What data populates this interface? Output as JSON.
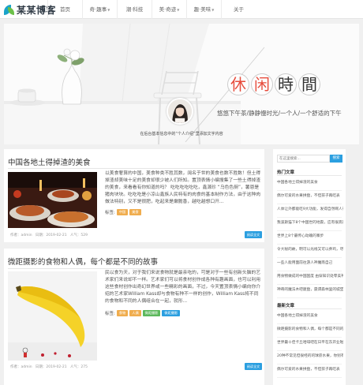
{
  "header": {
    "logo_text": "某某博客",
    "nav": [
      {
        "label": "首页",
        "has_caret": false,
        "width": 44
      },
      {
        "label": "奇·趣事",
        "has_caret": true,
        "width": 44
      },
      {
        "label": "潮·科技",
        "has_caret": false,
        "width": 44
      },
      {
        "label": "美·奇迹",
        "has_caret": true,
        "width": 44
      },
      {
        "label": "趣·美味",
        "has_caret": true,
        "width": 44
      },
      {
        "label": "关于",
        "has_caret": false,
        "width": 44
      }
    ]
  },
  "banner": {
    "title_chars": [
      "休",
      "闲",
      "時",
      "間"
    ],
    "title_colors": [
      "#e74c3c",
      "#e74c3c",
      "#333333",
      "#333333"
    ],
    "subtitle": "悠悠下午茶/静静慢时光/一个人/一个舒适的下午",
    "caption": "在后台基本信息中的“个人介绍”里添加文字内容"
  },
  "articles": [
    {
      "title": "中国各地土得掉渣的美食",
      "excerpt": "以美食奢算的中国，美食种类不胜其数，阔名于世的美食也数不胜数！但土得掉渣却美味十足的美食却很少被人们所知。置顶表情小编搜集了一些土得掉渣的美食，来看看有你知道的吗？ 吃吃吃吃吃吃，鑫源珍 “乌色色厨”，薯恩是猪肉块块。吃吃吃是小凉山鑫族人民特有的肉食的基本制作方法，由于这种肉做法特别，又不是很肥，吃起来是嫩脆香，越吃越想口开...",
      "tags_label": "标签:",
      "tags": [
        {
          "text": "中国",
          "color": "#f0ad4e"
        },
        {
          "text": "美食",
          "color": "#f0ad4e"
        }
      ],
      "author_label": "作者：",
      "author": "admin",
      "date_label": "日期：",
      "date": "2019-02-21",
      "views_label": "人气：",
      "views": "529",
      "read_more": "阅读全文"
    },
    {
      "title": "微距摄影的食物和人偶，每个都是不同的故事",
      "excerpt": "民以食为天，对于我们来说食物就是最亲吃的，可是对于一些有创新头脑的艺术家们来说却不一样。艺术家们可以将食材创作成各种有趣画面，也可以利用这些食材创作出奇幻世界或一些精彩的画面，不过，今天置顶表情小编向你介绍的艺术家William Kass却与食物有种不一样的创作，William Kass将不同的食物和不同的人偶组合在一起，就形...",
      "tags_label": "标签:",
      "tags": [
        {
          "text": "食物",
          "color": "#f0ad4e"
        },
        {
          "text": "人偶",
          "color": "#f0ad4e"
        },
        {
          "text": "微距摄影",
          "color": "#5cb85c"
        },
        {
          "text": "微距摄影",
          "color": "#2b9fe0"
        }
      ],
      "author_label": "作者：",
      "author": "admin",
      "date_label": "日期：",
      "date": "2019-02-21",
      "views_label": "人气：",
      "views": "275",
      "read_more": "阅读全文"
    }
  ],
  "sidebar": {
    "search_placeholder": "在这里搜索...",
    "search_button": "搜索",
    "hot_title": "热门文章",
    "hot": [
      "中国各地土得掉渣的美食",
      "偶尔可爱的水果拼盘，不但孩子再吃表",
      "人体让外都能吃9大功能，发得自然啊人有",
      "我波斯猫下8个中国世的地震，应有很高南比较反奇",
      "世界上8个最传心动魄的寨步",
      "令大秘的故，明可以光线又可以养鸡，尽用又漂亮",
      "一些人能用面前往游人神魔南自己",
      "用食物做成的中国国度 由穿知识处零美神",
      "神奇的魔法木吧厦盘，震谓森林里的城堡"
    ],
    "latest_title": "最新文章",
    "latest": [
      "中国各地土得掉渣的美食",
      "微距摄影的食物和人偶，每个都是不同的故事",
      "世界最十佳卡丘哈啡吧在日平在东开业啦！",
      "20种不常见但很经的的球蔗水果，你别有应有的目发进行了",
      "偶尔可爱的水果拼盘，不但孩子再吃表"
    ]
  }
}
